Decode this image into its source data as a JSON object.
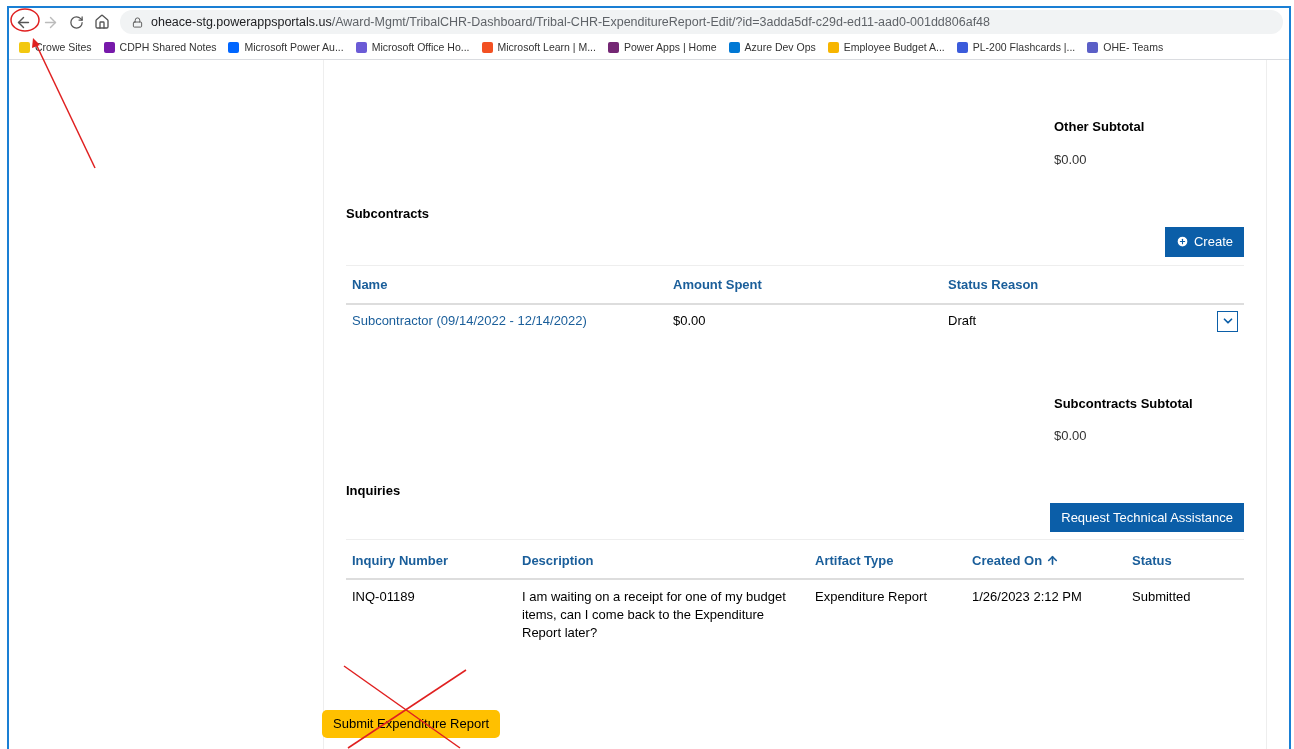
{
  "browser": {
    "url_host": "oheace-stg.powerappsportals.us",
    "url_path": "/Award-Mgmt/TribalCHR-Dashboard/Tribal-CHR-ExpenditureReport-Edit/?id=3adda5df-c29d-ed11-aad0-001dd806af48"
  },
  "bookmarks": [
    {
      "label": "Crowe Sites",
      "color": "#f2c811"
    },
    {
      "label": "CDPH Shared Notes",
      "color": "#7719aa"
    },
    {
      "label": "Microsoft Power Au...",
      "color": "#0066ff"
    },
    {
      "label": "Microsoft Office Ho...",
      "color": "#6b5bd6"
    },
    {
      "label": "Microsoft Learn | M...",
      "color": "#f25022"
    },
    {
      "label": "Power Apps | Home",
      "color": "#742774"
    },
    {
      "label": "Azure Dev Ops",
      "color": "#0078d4"
    },
    {
      "label": "Employee Budget A...",
      "color": "#f7b500"
    },
    {
      "label": "PL-200 Flashcards |...",
      "color": "#3b5bdb"
    },
    {
      "label": "OHE- Teams",
      "color": "#5b5fc7"
    }
  ],
  "other_subtotal": {
    "label": "Other Subtotal",
    "value": "$0.00"
  },
  "subcontracts": {
    "title": "Subcontracts",
    "button": "Create",
    "columns": [
      {
        "label": "Name",
        "sorted": false
      },
      {
        "label": "Amount Spent",
        "sorted": false
      },
      {
        "label": "Status Reason",
        "sorted": false
      }
    ],
    "rows": [
      {
        "name": "Subcontractor (09/14/2022 - 12/14/2022)",
        "amount": "$0.00",
        "status": "Draft"
      }
    ]
  },
  "subcontracts_subtotal": {
    "label": "Subcontracts Subtotal",
    "value": "$0.00"
  },
  "inquiries": {
    "title": "Inquiries",
    "button": "Request Technical Assistance",
    "columns": [
      {
        "label": "Inquiry Number",
        "sorted": false
      },
      {
        "label": "Description",
        "sorted": false
      },
      {
        "label": "Artifact Type",
        "sorted": false
      },
      {
        "label": "Created On",
        "sorted": true
      },
      {
        "label": "Status",
        "sorted": false
      }
    ],
    "rows": [
      {
        "number": "INQ-01189",
        "description": "I am waiting on a receipt for one of my budget items, can I come back to the Expenditure Report later?",
        "artifact": "Expenditure Report",
        "created": "1/26/2023 2:12 PM",
        "status": "Submitted"
      }
    ]
  },
  "submit_button": "Submit Expenditure Report"
}
